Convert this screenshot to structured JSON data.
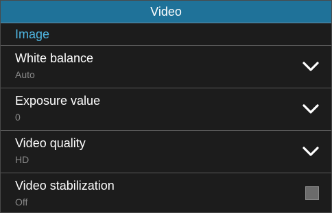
{
  "title": "Video",
  "section": "Image",
  "settings": [
    {
      "label": "White balance",
      "value": "Auto",
      "control": "chevron-down-icon"
    },
    {
      "label": "Exposure value",
      "value": "0",
      "control": "chevron-down-icon"
    },
    {
      "label": "Video quality",
      "value": "HD",
      "control": "chevron-down-icon"
    },
    {
      "label": "Video stabilization",
      "value": "Off",
      "control": "checkbox",
      "checked": false
    }
  ],
  "colors": {
    "title_bar": "#1f7299",
    "section_text": "#4fb7e3",
    "background": "#1c1c1c"
  }
}
